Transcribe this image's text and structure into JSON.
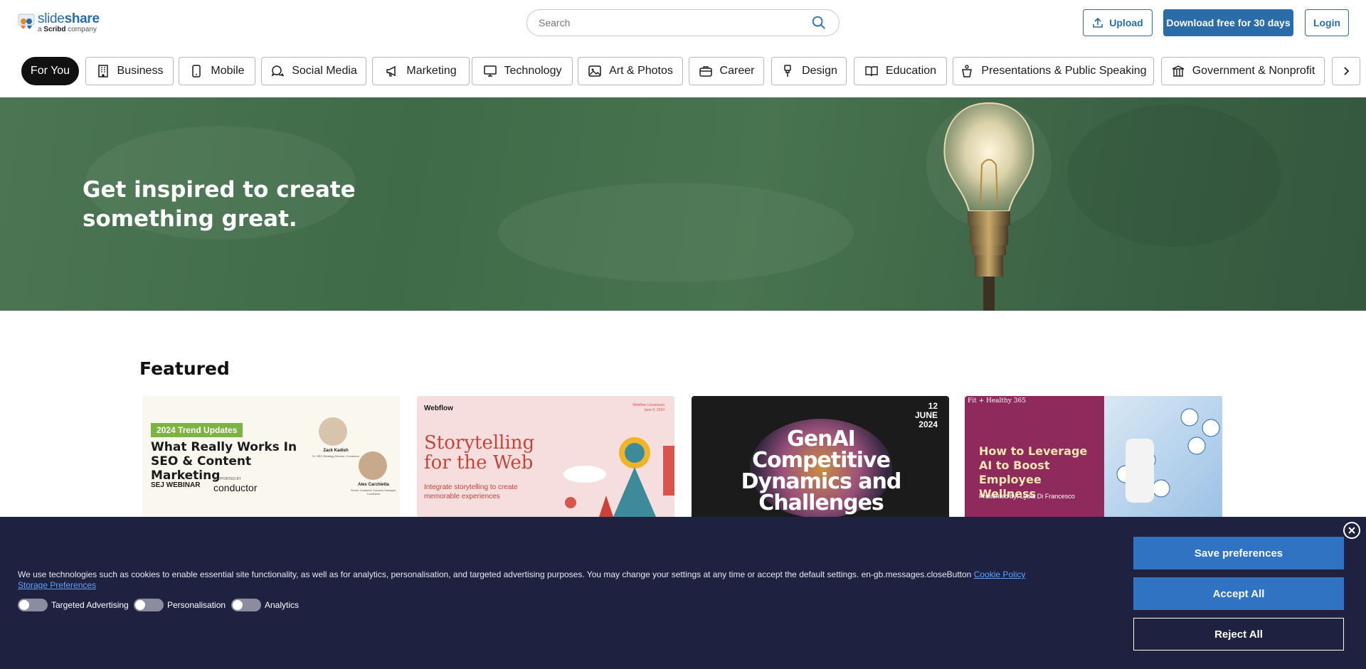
{
  "header": {
    "logo": {
      "main_light": "slide",
      "main_bold": "share",
      "sub_prefix": "a ",
      "sub_brand": "Scribd",
      "sub_suffix": " company"
    },
    "search_placeholder": "Search",
    "upload_label": "Upload",
    "download_label": "Download free for 30 days",
    "login_label": "Login"
  },
  "categories": [
    {
      "label": "For You",
      "icon": "none"
    },
    {
      "label": "Business",
      "icon": "building-icon"
    },
    {
      "label": "Mobile",
      "icon": "phone-icon"
    },
    {
      "label": "Social Media",
      "icon": "chat-icon"
    },
    {
      "label": "Marketing",
      "icon": "megaphone-icon"
    },
    {
      "label": "Technology",
      "icon": "monitor-icon"
    },
    {
      "label": "Art & Photos",
      "icon": "image-icon"
    },
    {
      "label": "Career",
      "icon": "briefcase-icon"
    },
    {
      "label": "Design",
      "icon": "paint-brush-icon"
    },
    {
      "label": "Education",
      "icon": "book-icon"
    },
    {
      "label": "Presentations & Public Speaking",
      "icon": "podium-icon"
    },
    {
      "label": "Government & Nonprofit",
      "icon": "government-icon"
    }
  ],
  "hero": {
    "title": "Get inspired to create something great."
  },
  "featured": {
    "heading": "Featured",
    "cards": [
      {
        "badge": "2024 Trend Updates",
        "title": "What Really Works In SEO & Content Marketing",
        "person1_name": "Zack Kadish",
        "person1_role": "Sr. SEO Strategy Director, Conductor",
        "person2_name": "Alex Carchietta",
        "person2_role": "Senior Customer Success Manager, Conductor",
        "footer_left": "SEJ WEBINAR",
        "footer_mid": "SUPPORTED BY",
        "footer_brand": "conductor"
      },
      {
        "brand": "Webflow",
        "event": "Webflow Livestream",
        "date": "June 5, 2024",
        "title": "Storytelling for the Web",
        "subtitle": "Integrate storytelling to create memorable experiences"
      },
      {
        "day": "12",
        "month": "JUNE",
        "year": "2024",
        "title": "GenAI Competitive Dynamics and Challenges"
      },
      {
        "brand": "Fit + Healthy 365",
        "title": "How to Leverage AI to Boost Employee Wellness",
        "presenter": "Presented by: Lydia Di Francesco"
      }
    ]
  },
  "cookie": {
    "text": "We use technologies such as cookies to enable essential site functionality, as well as for analytics, personalisation, and targeted advertising purposes. You may change your settings at any time or accept the default settings. en-gb.messages.closeButton",
    "cookie_policy_label": "Cookie Policy",
    "storage_label": "Storage Preferences",
    "toggles": [
      "Targeted Advertising",
      "Personalisation",
      "Analytics"
    ],
    "save_label": "Save preferences",
    "accept_label": "Accept All",
    "reject_label": "Reject All"
  },
  "colors": {
    "brand_blue": "#2a6ca8",
    "cookie_bg": "#1f2140",
    "hero_green": "#45704d"
  }
}
